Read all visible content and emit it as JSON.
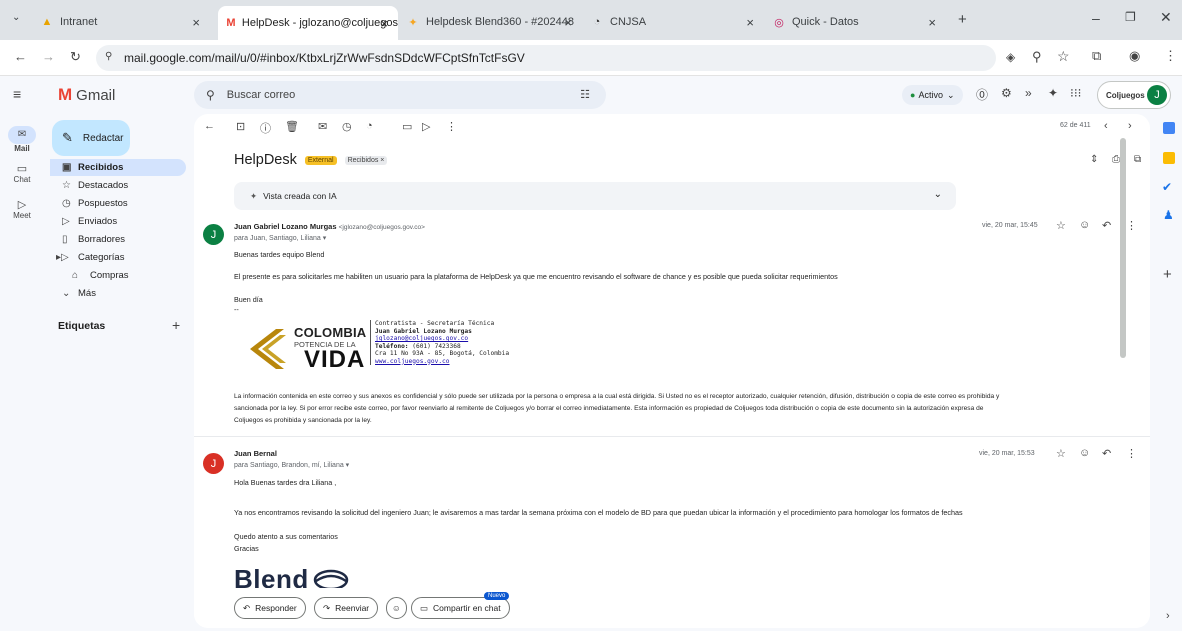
{
  "browser": {
    "tabs": [
      {
        "label": "Intranet",
        "active": false
      },
      {
        "label": "HelpDesk - jglozano@coljuegos",
        "active": true
      },
      {
        "label": "Helpdesk Blend360 - #202448",
        "active": false
      },
      {
        "label": "CNJSA",
        "active": false
      },
      {
        "label": "Quick - Datos",
        "active": false
      }
    ],
    "url": "mail.google.com/mail/u/0/#inbox/KtbxLrjZrWwFsdnSDdcWFCptSfnTctFsGV"
  },
  "gmail": {
    "logo": "Gmail",
    "search_placeholder": "Buscar correo",
    "status": "Activo",
    "account_label": "Coljuegos",
    "avatar_letter": "J"
  },
  "rail": {
    "mail": "Mail",
    "chat": "Chat",
    "meet": "Meet"
  },
  "sidebar": {
    "compose": "Redactar",
    "items": [
      {
        "label": "Recibidos",
        "icon": "inbox-icon"
      },
      {
        "label": "Destacados",
        "icon": "star-icon"
      },
      {
        "label": "Pospuestos",
        "icon": "clock-icon"
      },
      {
        "label": "Enviados",
        "icon": "send-icon"
      },
      {
        "label": "Borradores",
        "icon": "draft-icon"
      },
      {
        "label": "Categorías",
        "icon": "label-icon"
      },
      {
        "label": "Compras",
        "icon": "shopping-icon"
      },
      {
        "label": "Más",
        "icon": "chevron-down-icon"
      }
    ],
    "labels_title": "Etiquetas"
  },
  "toolbar": {
    "counter": "62 de 411"
  },
  "thread": {
    "subject": "HelpDesk",
    "chip_external": "External",
    "chip_inbox": "Recibidos ×",
    "ai_view": "Vista creada con IA"
  },
  "message1": {
    "avatar": "J",
    "sender": "Juan Gabriel Lozano Murgas",
    "email": "<jglozano@coljuegos.gov.co>",
    "to": "para Juan, Santiago, Liliana ▾",
    "date": "vie, 20 mar, 15:45",
    "greeting": "Buenas tardes equipo Blend",
    "body": "El presente es para solicitarles me habiliten un usuario para la plataforma de HelpDesk ya que me encuentro revisando el software de chance y es posible que pueda solicitar requerimientos",
    "closing": "Buen día",
    "dash": "--",
    "logo_line1": "COLOMBIA",
    "logo_line2": "POTENCIA DE LA",
    "logo_line3": "VIDA",
    "sig_role": "Contratista - Secretaría Técnica",
    "sig_name": "Juan Gabriel Lozano Murgas",
    "sig_email": "jglozano@coljuegos.gov.co",
    "sig_phone_label": "Teléfono:",
    "sig_phone": " (601) 7423368",
    "sig_address": "Cra 11 No 93A - 85, Bogotá, Colombia",
    "sig_web": "www.coljuegos.gov.co",
    "disclaimer1": "La información contenida en este correo y sus anexos es confidencial y sólo puede ser utilizada por la persona o empresa a la cual está dirigida. Si Usted no es el receptor autorizado, cualquier retención, difusión, distribución o copia de este correo es prohibida y",
    "disclaimer2": "sancionada por la ley. Si por error recibe este correo, por favor reenviarlo al remitente de Coljuegos y/o borrar el correo inmediatamente. Esta información es propiedad de Coljuegos toda distribución o copia de este documento sin la autorización expresa de",
    "disclaimer3": "Coljuegos es prohibida y sancionada por la ley."
  },
  "message2": {
    "avatar": "J",
    "sender": "Juan Bernal",
    "to": "para Santiago, Brandon, mí, Liliana ▾",
    "date": "vie, 20 mar, 15:53",
    "greeting": "Hola Buenas tardes dra Liliana ,",
    "body": "Ya nos encontramos revisando la solicitud del ingeniero Juan; le avisaremos a mas tardar la semana próxima con el modelo de BD para que puedan ubicar la información y el procedimiento para homologar los formatos de fechas",
    "closing1": "Quedo atento a sus comentarios",
    "closing2": "Gracias",
    "logo_text": "Blend"
  },
  "actions": {
    "reply": "Responder",
    "forward": "Reenviar",
    "share": "Compartir en chat",
    "new_badge": "Nuevo"
  }
}
